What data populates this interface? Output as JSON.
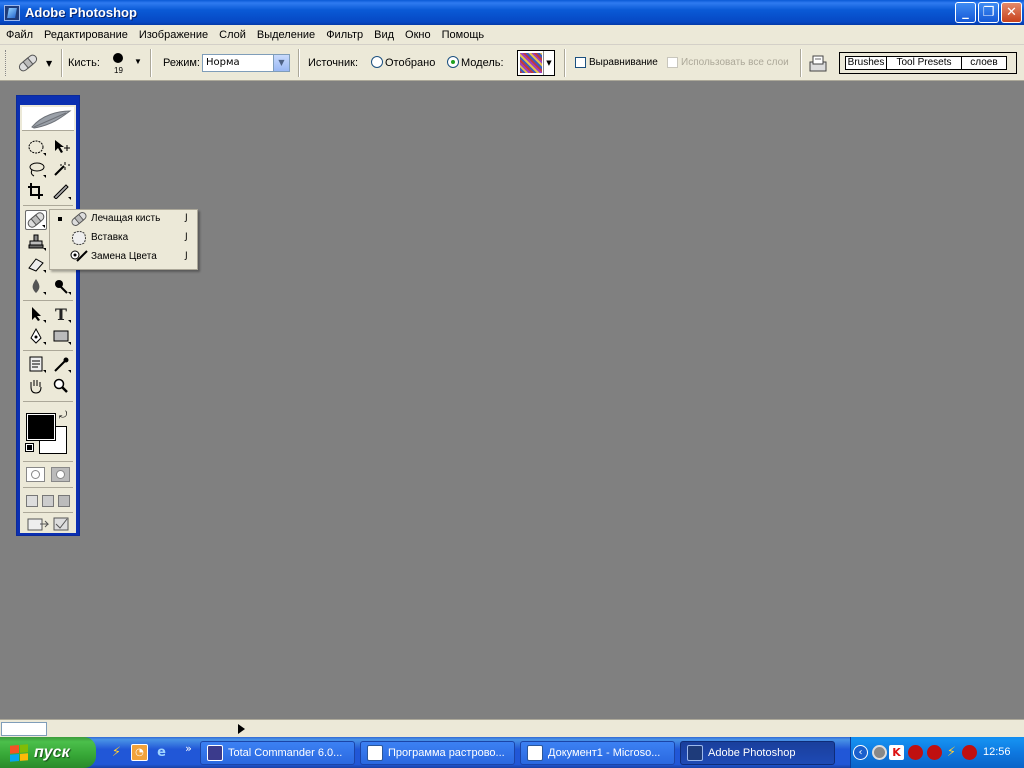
{
  "window": {
    "title": "Adobe Photoshop",
    "buttons": {
      "minimize": "_",
      "restore": "❐",
      "close": "✕"
    }
  },
  "menu": [
    "Файл",
    "Редактирование",
    "Изображение",
    "Слой",
    "Выделение",
    "Фильтр",
    "Вид",
    "Окно",
    "Помощь"
  ],
  "options": {
    "brush_label": "Кисть:",
    "brush_size": "19",
    "mode_label": "Режим:",
    "mode_value": "Норма",
    "source_label": "Источник:",
    "source_sampled": "Отобрано",
    "source_pattern": "Модель:",
    "source_selected": "pattern",
    "aligned_label": "Выравнивание",
    "aligned_checked": false,
    "use_all_layers_label": "Использовать все слои",
    "use_all_layers_enabled": false,
    "palette_well_tabs": [
      "Brushes",
      "Tool Presets",
      "слоев"
    ]
  },
  "toolbox": {
    "active_tool": "healing-brush",
    "foreground_color": "#000000",
    "background_color": "#ffffff"
  },
  "flyout": {
    "items": [
      {
        "label": "Лечащая кисть",
        "shortcut": "J",
        "selected": true,
        "icon": "healing-brush-icon"
      },
      {
        "label": "Вставка",
        "shortcut": "J",
        "selected": false,
        "icon": "patch-icon"
      },
      {
        "label": "Замена Цвета",
        "shortcut": "J",
        "selected": false,
        "icon": "color-replacement-icon"
      }
    ]
  },
  "taskbar": {
    "start_label": "пуск",
    "tasks": [
      {
        "label": "Total Commander 6.0...",
        "active": false
      },
      {
        "label": "Программа растрово...",
        "active": false
      },
      {
        "label": "Документ1 - Microso...",
        "active": false
      },
      {
        "label": "Adobe Photoshop",
        "active": true
      }
    ],
    "overflow_glyph": "»",
    "clock": "12:56"
  }
}
